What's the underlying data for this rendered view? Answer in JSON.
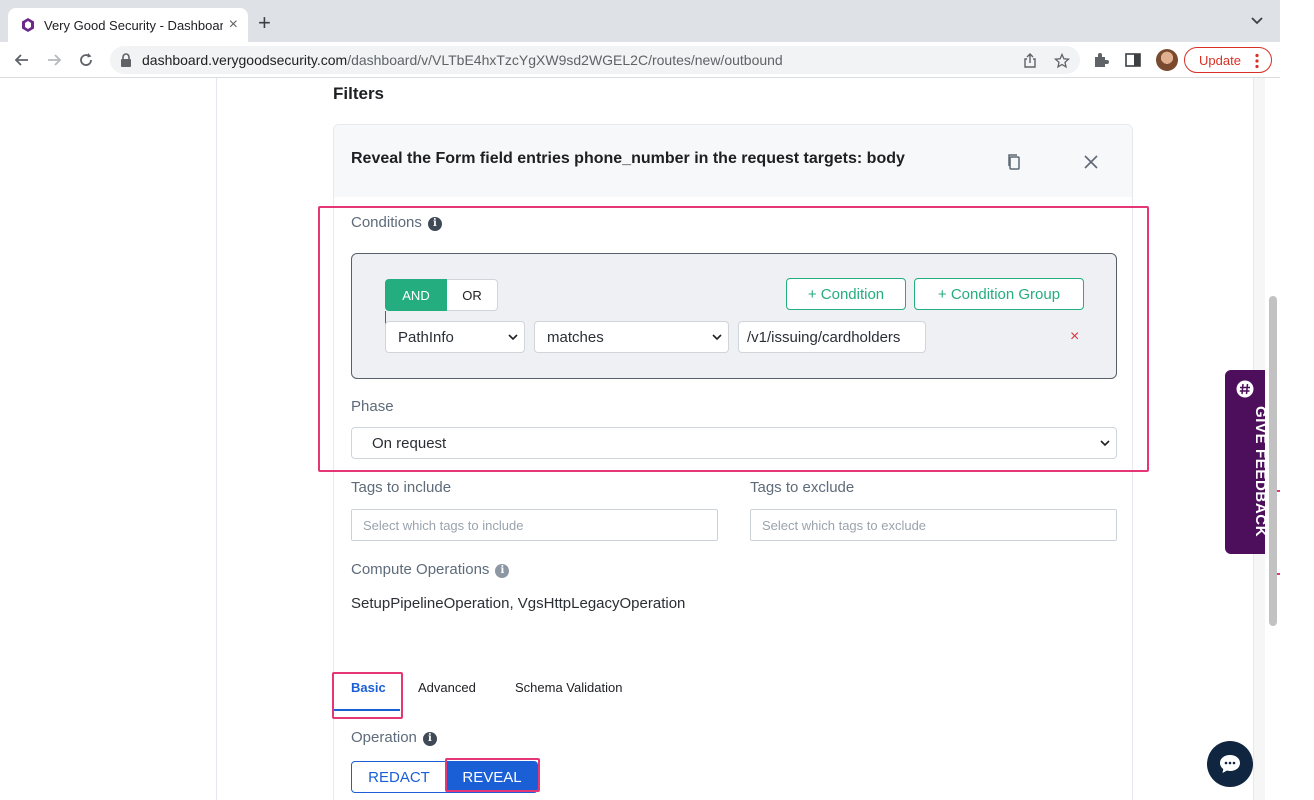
{
  "browser": {
    "tab_title": "Very Good Security - Dashboard",
    "tab_close": "×",
    "new_tab": "+",
    "url_host": "dashboard.verygoodsecurity.com",
    "url_path": "/dashboard/v/VLTbE4hxTzcYgXW9sd2WGEL2C/routes/new/outbound",
    "update_label": "Update"
  },
  "page": {
    "filters_title": "Filters",
    "filter_heading": "Reveal the Form field entries phone_number in the request targets: body",
    "conditions_label": "Conditions",
    "and_label": "AND",
    "or_label": "OR",
    "add_condition_label": "+ Condition",
    "add_condition_group_label": "+ Condition Group",
    "condition": {
      "field": "PathInfo",
      "operator": "matches",
      "value": "/v1/issuing/cardholders",
      "remove": "×"
    },
    "phase_label": "Phase",
    "phase_value": "On request",
    "tags_include_label": "Tags to include",
    "tags_include_placeholder": "Select which tags to include",
    "tags_exclude_label": "Tags to exclude",
    "tags_exclude_placeholder": "Select which tags to exclude",
    "compute_label": "Compute Operations",
    "compute_value": "SetupPipelineOperation, VgsHttpLegacyOperation",
    "tabs": [
      {
        "label": "Basic",
        "active": true
      },
      {
        "label": "Advanced",
        "active": false
      },
      {
        "label": "Schema Validation",
        "active": false
      }
    ],
    "operation_label": "Operation",
    "op_redact": "REDACT",
    "op_reveal": "REVEAL",
    "feedback_label": "GIVE FEEDBACK",
    "info_glyph": "i"
  },
  "colors": {
    "accent_green": "#24ad7e",
    "primary_blue": "#1a5fd6",
    "highlight_pink": "#e53775",
    "feedback_purple": "#4d0f5c",
    "chat_navy": "#10253f"
  }
}
